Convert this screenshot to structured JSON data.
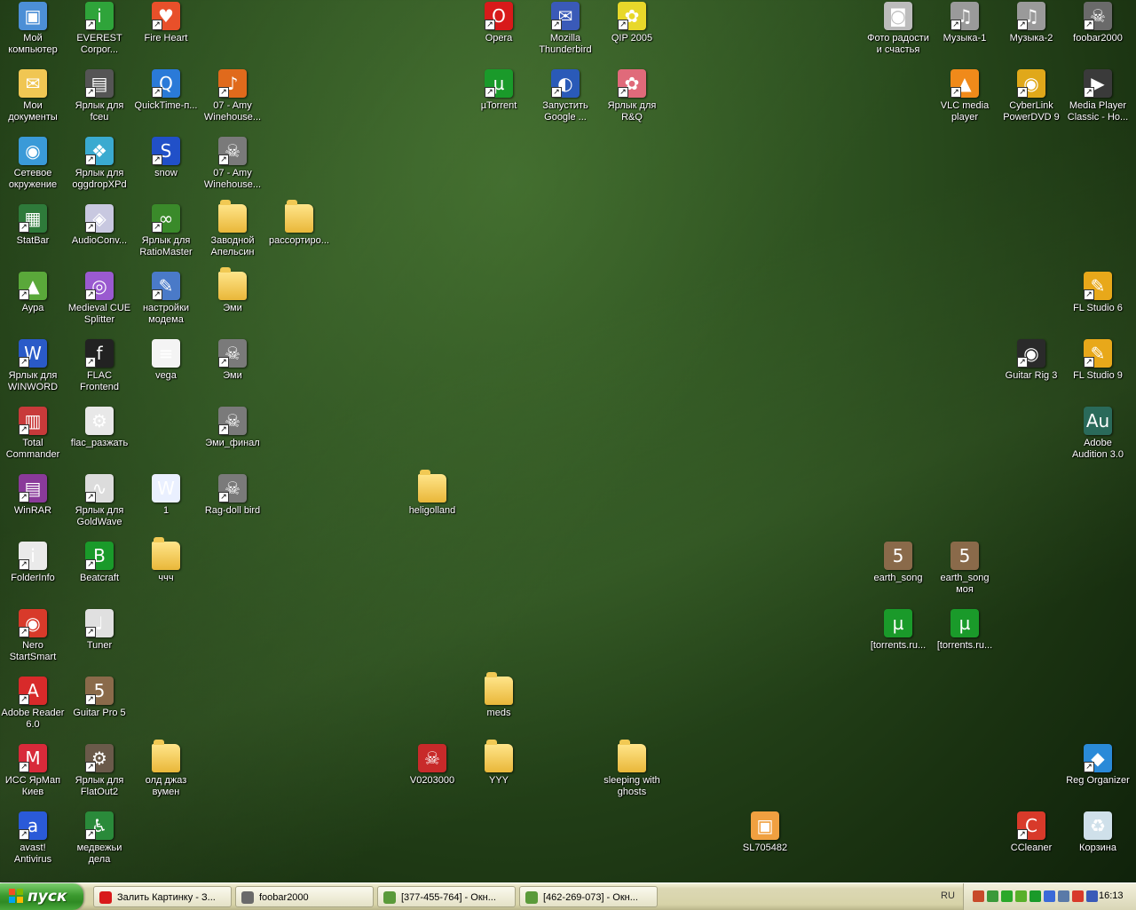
{
  "icons": [
    {
      "label": "Мой\nкомпьютер",
      "icon": "my-computer-icon",
      "color": "#4c8fd6",
      "glyph": "▣",
      "folder": false,
      "shortcut": false
    },
    {
      "label": "EVEREST\nCorpor...",
      "icon": "everest-icon",
      "color": "#2fa43a",
      "glyph": "i",
      "folder": false,
      "shortcut": true
    },
    {
      "label": "Fire Heart",
      "icon": "fire-heart-icon",
      "color": "#e8502a",
      "glyph": "♥",
      "folder": false,
      "shortcut": true
    },
    {
      "label": "Мои\nдокументы",
      "icon": "my-documents-icon",
      "color": "#f0c653",
      "glyph": "✉",
      "folder": false,
      "shortcut": false
    },
    {
      "label": "Ярлык для\nfceu",
      "icon": "fceu-icon",
      "color": "#555555",
      "glyph": "▤",
      "folder": false,
      "shortcut": true
    },
    {
      "label": "QuickTime-п...",
      "icon": "quicktime-icon",
      "color": "#2a7ad8",
      "glyph": "Q",
      "folder": false,
      "shortcut": true
    },
    {
      "label": "07 - Amy\nWinehouse...",
      "icon": "flac-file-icon",
      "color": "#e06a1c",
      "glyph": "♪",
      "folder": false,
      "shortcut": true
    },
    {
      "label": "Сетевое\nокружение",
      "icon": "network-icon",
      "color": "#3a9ad8",
      "glyph": "◉",
      "folder": false,
      "shortcut": false
    },
    {
      "label": "Ярлык для\noggdropXPd",
      "icon": "oggdrop-icon",
      "color": "#3aaad0",
      "glyph": "❖",
      "folder": false,
      "shortcut": true
    },
    {
      "label": "snow",
      "icon": "snow-icon",
      "color": "#2150c8",
      "glyph": "S",
      "folder": false,
      "shortcut": true
    },
    {
      "label": "07 - Amy\nWinehouse...",
      "icon": "wav-file-icon",
      "color": "#7a7a7a",
      "glyph": "☠",
      "folder": false,
      "shortcut": true
    },
    {
      "label": "StatBar",
      "icon": "statbar-icon",
      "color": "#2e7a3a",
      "glyph": "▦",
      "folder": false,
      "shortcut": true
    },
    {
      "label": "AudioConv...",
      "icon": "audioconv-icon",
      "color": "#c8c8e0",
      "glyph": "◈",
      "folder": false,
      "shortcut": true
    },
    {
      "label": "Ярлык для\nRatioMaster",
      "icon": "ratiomaster-icon",
      "color": "#3a8a2a",
      "glyph": "∞",
      "folder": false,
      "shortcut": true
    },
    {
      "label": "Заводной\nАпельсин",
      "icon": "folder-icon",
      "color": "#f0c653",
      "glyph": "",
      "folder": true,
      "shortcut": false
    },
    {
      "label": "рассортиро...",
      "icon": "folder-icon",
      "color": "#f0c653",
      "glyph": "",
      "folder": true,
      "shortcut": false
    },
    {
      "label": "Аура",
      "icon": "aura-icon",
      "color": "#5aa83a",
      "glyph": "▲",
      "folder": false,
      "shortcut": true
    },
    {
      "label": "Medieval CUE\nSplitter",
      "icon": "cue-splitter-icon",
      "color": "#9a5ad0",
      "glyph": "◎",
      "folder": false,
      "shortcut": true
    },
    {
      "label": "настройки\nмодема",
      "icon": "modem-settings-icon",
      "color": "#4a7ac8",
      "glyph": "✎",
      "folder": false,
      "shortcut": true
    },
    {
      "label": "Эми",
      "icon": "folder-icon",
      "color": "#f0c653",
      "glyph": "",
      "folder": true,
      "shortcut": false
    },
    {
      "label": "Ярлык для\nWINWORD",
      "icon": "word-icon",
      "color": "#2a5ac8",
      "glyph": "W",
      "folder": false,
      "shortcut": true
    },
    {
      "label": "FLAC\nFrontend",
      "icon": "flac-frontend-icon",
      "color": "#222222",
      "glyph": "f",
      "folder": false,
      "shortcut": true
    },
    {
      "label": "vega",
      "icon": "text-file-icon",
      "color": "#f4f4f4",
      "glyph": "≡",
      "folder": false,
      "shortcut": false
    },
    {
      "label": "Эми",
      "icon": "wav-file-icon",
      "color": "#7a7a7a",
      "glyph": "☠",
      "folder": false,
      "shortcut": true
    },
    {
      "label": "Total\nCommander",
      "icon": "total-commander-icon",
      "color": "#c83a3a",
      "glyph": "▥",
      "folder": false,
      "shortcut": true
    },
    {
      "label": "flac_разжать",
      "icon": "batch-file-icon",
      "color": "#e8e8e8",
      "glyph": "⚙",
      "folder": false,
      "shortcut": false
    },
    {
      "label": "Эми_финал",
      "icon": "wav-file-icon",
      "color": "#7a7a7a",
      "glyph": "☠",
      "folder": false,
      "shortcut": true
    },
    {
      "label": "WinRAR",
      "icon": "winrar-icon",
      "color": "#8a3a9a",
      "glyph": "▤",
      "folder": false,
      "shortcut": true
    },
    {
      "label": "Ярлык для\nGoldWave",
      "icon": "goldwave-icon",
      "color": "#dcdcdc",
      "glyph": "∿",
      "folder": false,
      "shortcut": true
    },
    {
      "label": "1",
      "icon": "word-document-icon",
      "color": "#eaf0ff",
      "glyph": "W",
      "folder": false,
      "shortcut": false
    },
    {
      "label": "Rag-doll bird",
      "icon": "wav-file-icon",
      "color": "#7a7a7a",
      "glyph": "☠",
      "folder": false,
      "shortcut": true
    },
    {
      "label": "heligolland",
      "icon": "folder-icon",
      "color": "#f0c653",
      "glyph": "",
      "folder": true,
      "shortcut": false
    },
    {
      "label": "FolderInfo",
      "icon": "folderinfo-icon",
      "color": "#eaeaea",
      "glyph": "i",
      "folder": false,
      "shortcut": true
    },
    {
      "label": "Beatcraft",
      "icon": "beatcraft-icon",
      "color": "#1a9a2a",
      "glyph": "B",
      "folder": false,
      "shortcut": true
    },
    {
      "label": "ччч",
      "icon": "folder-icon",
      "color": "#f0c653",
      "glyph": "",
      "folder": true,
      "shortcut": false
    },
    {
      "label": "earth_song",
      "icon": "guitar-pro-file-icon",
      "color": "#8a6a4a",
      "glyph": "5",
      "folder": false,
      "shortcut": false
    },
    {
      "label": "earth_song\nмоя",
      "icon": "guitar-pro-file-icon",
      "color": "#8a6a4a",
      "glyph": "5",
      "folder": false,
      "shortcut": false
    },
    {
      "label": "Nero\nStartSmart",
      "icon": "nero-icon",
      "color": "#d83a2a",
      "glyph": "◉",
      "folder": false,
      "shortcut": true
    },
    {
      "label": "Tuner",
      "icon": "tuner-icon",
      "color": "#e0e0e0",
      "glyph": "♩",
      "folder": false,
      "shortcut": true
    },
    {
      "label": "[torrents.ru...",
      "icon": "utorrent-file-icon",
      "color": "#1a9a2a",
      "glyph": "µ",
      "folder": false,
      "shortcut": false
    },
    {
      "label": "[torrents.ru...",
      "icon": "utorrent-file-icon",
      "color": "#1a9a2a",
      "glyph": "µ",
      "folder": false,
      "shortcut": false
    },
    {
      "label": "Adobe Reader\n6.0",
      "icon": "adobe-reader-icon",
      "color": "#d82a2a",
      "glyph": "A",
      "folder": false,
      "shortcut": true
    },
    {
      "label": "Guitar Pro 5",
      "icon": "guitar-pro-icon",
      "color": "#8a6a4a",
      "glyph": "5",
      "folder": false,
      "shortcut": true
    },
    {
      "label": "meds",
      "icon": "folder-icon",
      "color": "#f0c653",
      "glyph": "",
      "folder": true,
      "shortcut": false
    },
    {
      "label": "ИСС ЯрМап\nКиев",
      "icon": "yarmap-icon",
      "color": "#d82a3a",
      "glyph": "M",
      "folder": false,
      "shortcut": true
    },
    {
      "label": "Ярлык для\nFlatOut2",
      "icon": "flatout-icon",
      "color": "#6a5a4a",
      "glyph": "⚙",
      "folder": false,
      "shortcut": true
    },
    {
      "label": "олд джаз\nвумен",
      "icon": "folder-icon",
      "color": "#f0c653",
      "glyph": "",
      "folder": true,
      "shortcut": false
    },
    {
      "label": "V0203000",
      "icon": "mp3-file-icon",
      "color": "#c82a2a",
      "glyph": "☠",
      "folder": false,
      "shortcut": false
    },
    {
      "label": "YYY",
      "icon": "folder-icon",
      "color": "#f0c653",
      "glyph": "",
      "folder": true,
      "shortcut": false
    },
    {
      "label": "sleeping with\nghosts",
      "icon": "folder-icon",
      "color": "#f0c653",
      "glyph": "",
      "folder": true,
      "shortcut": false
    },
    {
      "label": "avast!\nAntivirus",
      "icon": "avast-icon",
      "color": "#2a5ad8",
      "glyph": "a",
      "folder": false,
      "shortcut": true
    },
    {
      "label": "медвежьи\nдела",
      "icon": "game-icon",
      "color": "#2a8a3a",
      "glyph": "♿",
      "folder": false,
      "shortcut": true
    },
    {
      "label": "SL705482",
      "icon": "image-file-icon",
      "color": "#f0a040",
      "glyph": "▣",
      "folder": false,
      "shortcut": false
    },
    {
      "label": "Opera",
      "icon": "opera-icon",
      "color": "#d81a1a",
      "glyph": "O",
      "folder": false,
      "shortcut": true
    },
    {
      "label": "Mozilla\nThunderbird",
      "icon": "thunderbird-icon",
      "color": "#3a5ab8",
      "glyph": "✉",
      "folder": false,
      "shortcut": true
    },
    {
      "label": "QIP 2005",
      "icon": "qip-icon",
      "color": "#e8d82a",
      "glyph": "✿",
      "folder": false,
      "shortcut": true
    },
    {
      "label": "µTorrent",
      "icon": "utorrent-icon",
      "color": "#1a9a2a",
      "glyph": "µ",
      "folder": false,
      "shortcut": true
    },
    {
      "label": "Запустить\nGoogle ...",
      "icon": "google-earth-icon",
      "color": "#2a5ab8",
      "glyph": "◐",
      "folder": false,
      "shortcut": true
    },
    {
      "label": "Ярлык для\nR&Q",
      "icon": "rnq-icon",
      "color": "#e06a7a",
      "glyph": "✿",
      "folder": false,
      "shortcut": true
    },
    {
      "label": "Фото радости\nи счастья",
      "icon": "camera-icon",
      "color": "#bcbcbc",
      "glyph": "◙",
      "folder": false,
      "shortcut": false
    },
    {
      "label": "Музыка-1",
      "icon": "music-drive-icon",
      "color": "#9a9a9a",
      "glyph": "♫",
      "folder": false,
      "shortcut": true
    },
    {
      "label": "Музыка-2",
      "icon": "music-drive-icon",
      "color": "#9a9a9a",
      "glyph": "♫",
      "folder": false,
      "shortcut": true
    },
    {
      "label": "foobar2000",
      "icon": "foobar-icon",
      "color": "#6a6a6a",
      "glyph": "☠",
      "folder": false,
      "shortcut": true
    },
    {
      "label": "VLC media\nplayer",
      "icon": "vlc-icon",
      "color": "#f08a1a",
      "glyph": "▲",
      "folder": false,
      "shortcut": true
    },
    {
      "label": "CyberLink\nPowerDVD 9",
      "icon": "powerdvd-icon",
      "color": "#e0a81a",
      "glyph": "◉",
      "folder": false,
      "shortcut": true
    },
    {
      "label": "Media Player\nClassic - Ho...",
      "icon": "mpc-icon",
      "color": "#3a3a3a",
      "glyph": "▶",
      "folder": false,
      "shortcut": true
    },
    {
      "label": "FL Studio 6",
      "icon": "fl-studio-icon",
      "color": "#e8a81a",
      "glyph": "✎",
      "folder": false,
      "shortcut": true
    },
    {
      "label": "Guitar Rig 3",
      "icon": "guitar-rig-icon",
      "color": "#2a2a2a",
      "glyph": "◉",
      "folder": false,
      "shortcut": true
    },
    {
      "label": "FL Studio 9",
      "icon": "fl-studio-icon",
      "color": "#e8a81a",
      "glyph": "✎",
      "folder": false,
      "shortcut": true
    },
    {
      "label": "Adobe\nAudition 3.0",
      "icon": "audition-icon",
      "color": "#2a6a5a",
      "glyph": "Au",
      "folder": false,
      "shortcut": false
    },
    {
      "label": "Reg Organizer",
      "icon": "reg-organizer-icon",
      "color": "#2a8ad8",
      "glyph": "◆",
      "folder": false,
      "shortcut": true
    },
    {
      "label": "CCleaner",
      "icon": "ccleaner-icon",
      "color": "#d83a2a",
      "glyph": "C",
      "folder": false,
      "shortcut": true
    },
    {
      "label": "Корзина",
      "icon": "recycle-bin-icon",
      "color": "#cfe0ea",
      "glyph": "♻",
      "folder": false,
      "shortcut": false
    }
  ],
  "taskbar": {
    "start_label": "пуск",
    "tasks": [
      {
        "label": "Залить Картинку - З...",
        "icon": "opera-icon",
        "color": "#d81a1a"
      },
      {
        "label": "foobar2000",
        "icon": "foobar-icon",
        "color": "#6a6a6a"
      },
      {
        "label": "[377-455-764] - Окн...",
        "icon": "window-icon",
        "color": "#5a9a3a"
      },
      {
        "label": "[462-269-073] - Окн...",
        "icon": "window-icon",
        "color": "#5a9a3a"
      }
    ],
    "language": "RU",
    "clock": "16:13",
    "tray_icons": [
      {
        "name": "tray-arrow-icon",
        "color": "#c84a2a"
      },
      {
        "name": "tray-network-icon",
        "color": "#3a9a3a"
      },
      {
        "name": "tray-clover-icon",
        "color": "#2aa82a"
      },
      {
        "name": "tray-qip-icon",
        "color": "#58b02a"
      },
      {
        "name": "tray-utorrent-icon",
        "color": "#1a9a2a"
      },
      {
        "name": "tray-monitor-icon",
        "color": "#3a6ad8"
      },
      {
        "name": "tray-volume-icon",
        "color": "#5a7aa8"
      },
      {
        "name": "tray-security-icon",
        "color": "#d83a2a"
      },
      {
        "name": "tray-mail-icon",
        "color": "#3a5ab8"
      }
    ]
  }
}
